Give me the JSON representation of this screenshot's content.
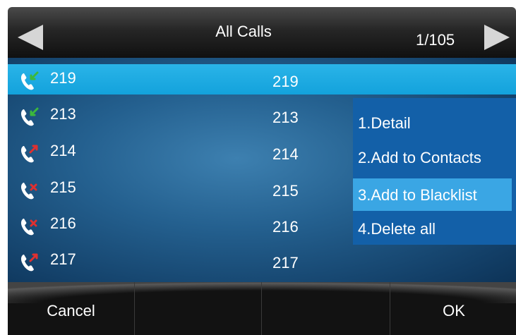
{
  "header": {
    "title": "All Calls",
    "page_indicator": "1/105",
    "prev_icon": "left-arrow-icon",
    "next_icon": "right-arrow-icon"
  },
  "calls": [
    {
      "number": "219",
      "name": "219",
      "type": "received",
      "selected": true
    },
    {
      "number": "213",
      "name": "213",
      "type": "received",
      "selected": false
    },
    {
      "number": "214",
      "name": "214",
      "type": "dialed",
      "selected": false
    },
    {
      "number": "215",
      "name": "215",
      "type": "missed",
      "selected": false
    },
    {
      "number": "216",
      "name": "216",
      "type": "missed",
      "selected": false
    },
    {
      "number": "217",
      "name": "217",
      "type": "dialed",
      "selected": false
    }
  ],
  "menu": {
    "items": [
      {
        "label": "1.Detail",
        "highlighted": false
      },
      {
        "label": "2.Add to Contacts",
        "highlighted": false
      },
      {
        "label": "3.Add to Blacklist",
        "highlighted": true
      },
      {
        "label": "4.Delete all",
        "highlighted": false
      }
    ]
  },
  "softkeys": [
    {
      "label": "Cancel"
    },
    {
      "label": ""
    },
    {
      "label": ""
    },
    {
      "label": "OK"
    }
  ],
  "colors": {
    "selected_row": "#19a8e0",
    "menu_bg": "#1360a8",
    "menu_highlight": "#3aa6e4",
    "received_mark": "#3cb83c",
    "dialed_mark": "#e03030",
    "missed_mark": "#e03030"
  }
}
